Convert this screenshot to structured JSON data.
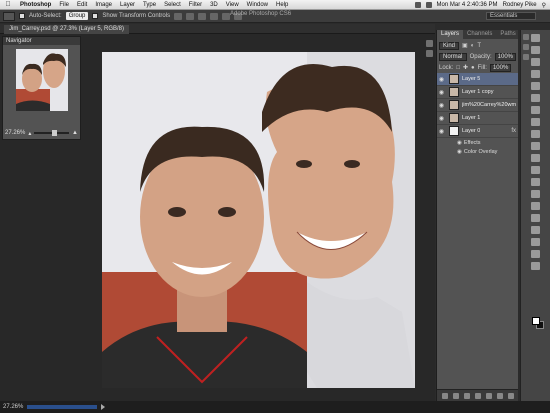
{
  "menubar": {
    "items": [
      "Photoshop",
      "File",
      "Edit",
      "Image",
      "Layer",
      "Type",
      "Select",
      "Filter",
      "3D",
      "View",
      "Window",
      "Help"
    ],
    "clock": "Mon Mar 4  2:40:36 PM",
    "user": "Rodney Pike"
  },
  "options": {
    "auto_select_label": "Auto-Select:",
    "auto_select_value": "Group",
    "transform_label": "Show Transform Controls",
    "app_title": "Adobe Photoshop CS6",
    "workspace": "Essentials"
  },
  "document": {
    "tab_title": "Jim_Carrey.psd @ 27.3% (Layer 5, RGB/8)"
  },
  "navigator": {
    "title": "Navigator",
    "zoom": "27.26%"
  },
  "layers": {
    "tabs": [
      "Layers",
      "Channels",
      "Paths"
    ],
    "kind_label": "Kind",
    "blend_mode": "Normal",
    "opacity_label": "Opacity:",
    "opacity_value": "100%",
    "lock_label": "Lock:",
    "fill_label": "Fill:",
    "fill_value": "100%",
    "items": [
      {
        "name": "Layer 5"
      },
      {
        "name": "Layer 1 copy"
      },
      {
        "name": "jim%20Carrey%20wm"
      },
      {
        "name": "Layer 1"
      },
      {
        "name": "Layer 0"
      }
    ],
    "effects_label": "Effects",
    "effect_name": "Color Overlay"
  },
  "status": {
    "zoom": "27.26%"
  },
  "colors": {
    "selected_layer": "#5b6a88",
    "panel_bg": "#535353",
    "accent": "#2a4f8c"
  }
}
